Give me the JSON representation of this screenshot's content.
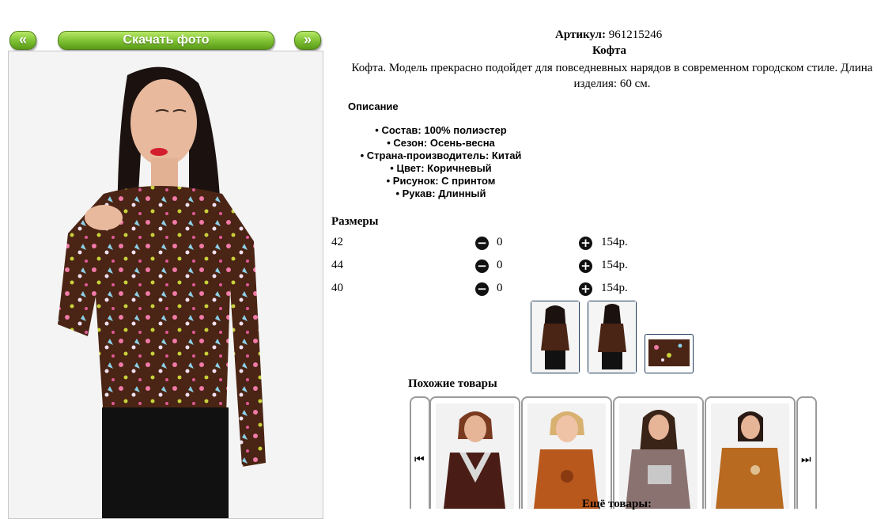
{
  "nav": {
    "prev_label": "«",
    "download_label": "Скачать фото",
    "next_label": "»"
  },
  "product": {
    "article_label": "Артикул:",
    "article_value": "961215246",
    "name": "Кофта",
    "description": "Кофта. Модель прекрасно подойдет для повседневных нарядов в современном городском стиле. Длина изделия: 60 см."
  },
  "details": {
    "title": "Описание",
    "items": [
      "Состав: 100% полиэстер",
      "Сезон: Осень-весна",
      "Страна-производитель: Китай",
      "Цвет: Коричневый",
      "Рисунок: С принтом",
      "Рукав: Длинный"
    ]
  },
  "sizes": {
    "title": "Размеры",
    "rows": [
      {
        "size": "42",
        "qty": "0",
        "price": "154р."
      },
      {
        "size": "44",
        "qty": "0",
        "price": "154р."
      },
      {
        "size": "40",
        "qty": "0",
        "price": "154р."
      }
    ]
  },
  "similar": {
    "title": "Похожие товары",
    "more_label": "Ещё товары:"
  },
  "colors": {
    "brand_green": "#6fb126",
    "blouse_brown": "#4a2414",
    "thumb_border": "#1e3a5a"
  },
  "icons": {
    "minus": "minus-circle-icon",
    "plus": "plus-circle-icon",
    "first": "skip-first-icon",
    "last": "skip-last-icon"
  }
}
